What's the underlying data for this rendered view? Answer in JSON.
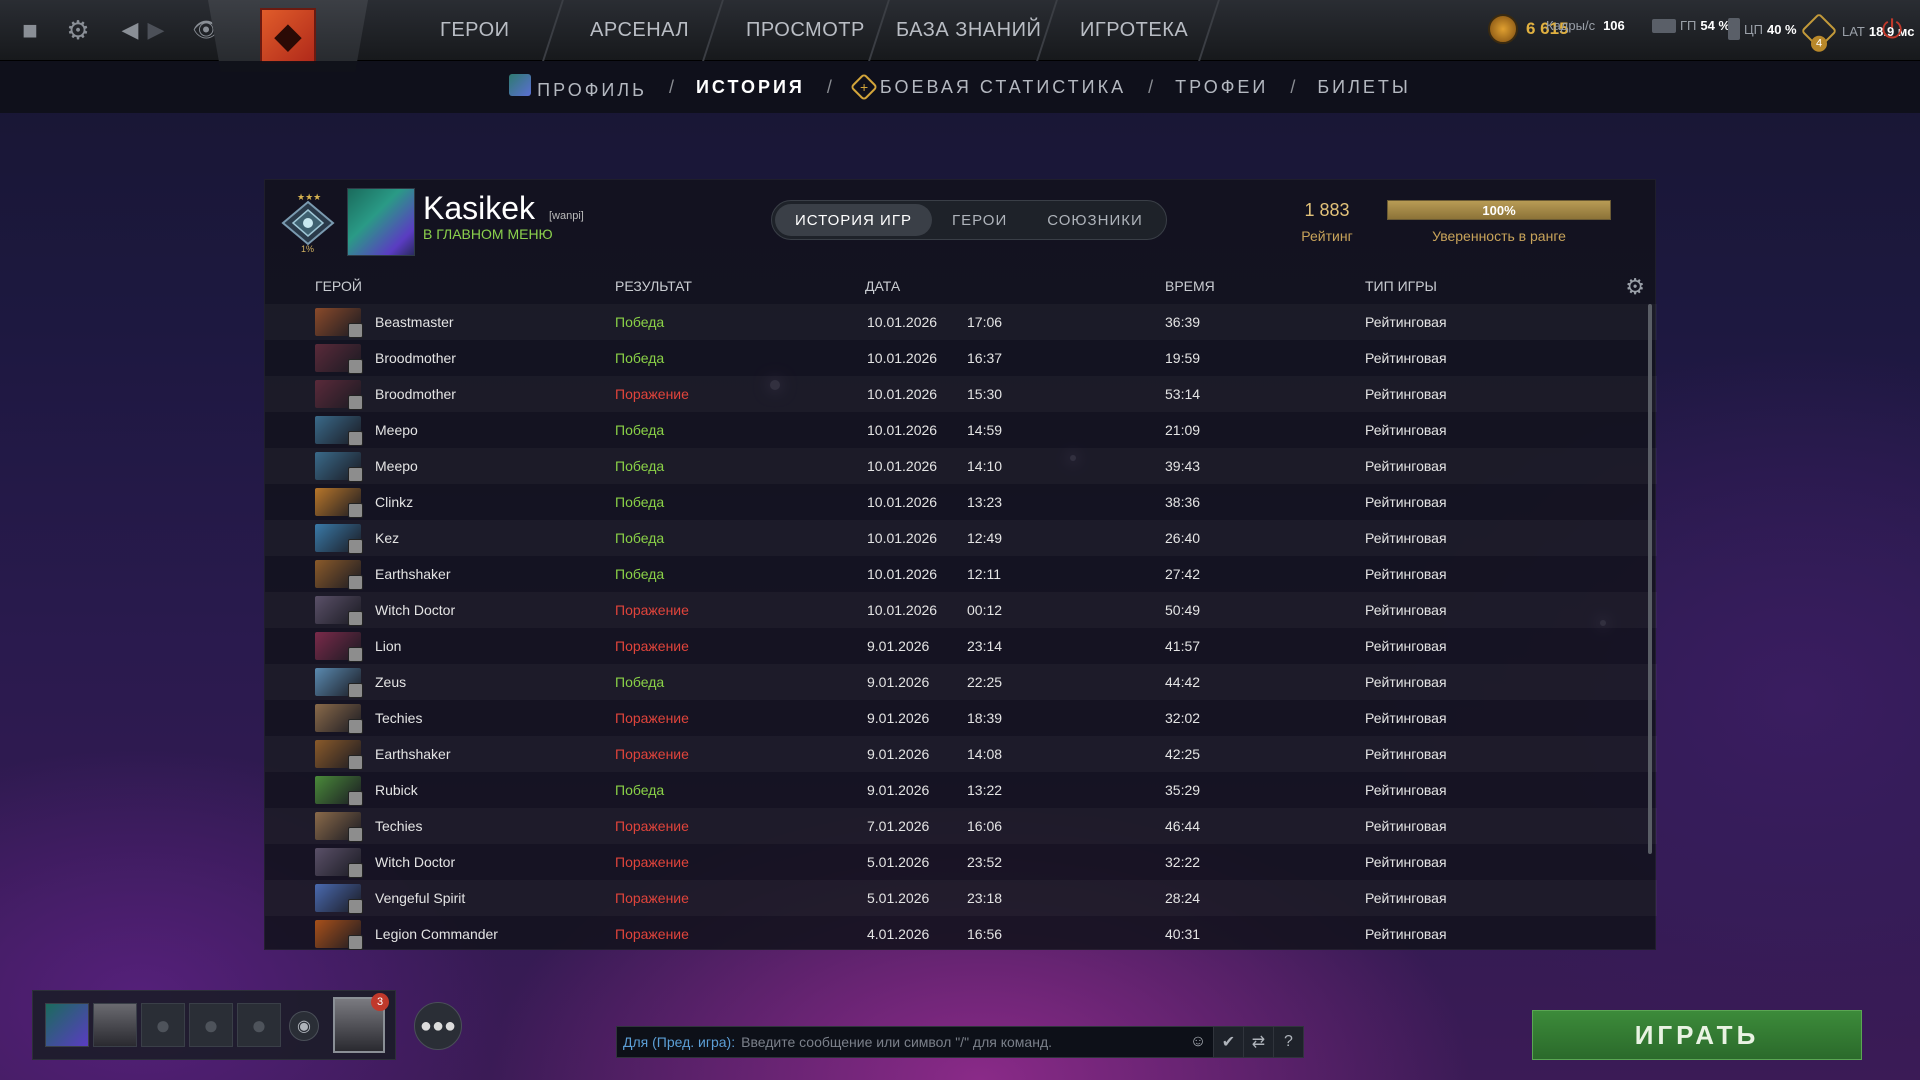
{
  "topbar": {
    "nav": [
      "ГЕРОИ",
      "АРСЕНАЛ",
      "ПРОСМОТР",
      "БАЗА ЗНАНИЙ",
      "ИГРОТЕКА"
    ],
    "stats": {
      "fps_label": "Кадры/с",
      "fps": "106",
      "gpu_label": "ГП",
      "gpu": "54 %",
      "cpu_label": "ЦП",
      "cpu": "40 %",
      "lat_label": "LAT",
      "lat": "18.9 мс",
      "shards": "6 615",
      "badge_count": "4"
    }
  },
  "subnav": {
    "items": [
      "ПРОФИЛЬ",
      "ИСТОРИЯ",
      "БОЕВАЯ СТАТИСТИКА",
      "ТРОФЕИ",
      "БИЛЕТЫ"
    ],
    "active": "ИСТОРИЯ",
    "separator": "/"
  },
  "profile": {
    "name": "Kasikek",
    "tag": "[wanpi]",
    "status": "В ГЛАВНОМ МЕНЮ",
    "rank_percent": "1%",
    "tabs": [
      "ИСТОРИЯ ИГР",
      "ГЕРОИ",
      "СОЮЗНИКИ"
    ],
    "active_tab": "ИСТОРИЯ ИГР",
    "rating_value": "1 883",
    "rating_label": "Рейтинг",
    "confidence_value": "100%",
    "confidence_fraction": 1.0,
    "confidence_label": "Уверенность в ранге"
  },
  "table": {
    "headers": {
      "hero": "ГЕРОЙ",
      "result": "РЕЗУЛЬТАТ",
      "date": "ДАТА",
      "duration": "ВРЕМЯ",
      "type": "ТИП ИГРЫ"
    },
    "rows": [
      {
        "hero": "Beastmaster",
        "result": "Победа",
        "win": true,
        "date": "10.01.2026",
        "time": "17:06",
        "duration": "36:39",
        "type": "Рейтинговая",
        "color": "#8a4a2a"
      },
      {
        "hero": "Broodmother",
        "result": "Победа",
        "win": true,
        "date": "10.01.2026",
        "time": "16:37",
        "duration": "19:59",
        "type": "Рейтинговая",
        "color": "#5a2a3a"
      },
      {
        "hero": "Broodmother",
        "result": "Поражение",
        "win": false,
        "date": "10.01.2026",
        "time": "15:30",
        "duration": "53:14",
        "type": "Рейтинговая",
        "color": "#5a2a3a"
      },
      {
        "hero": "Meepo",
        "result": "Победа",
        "win": true,
        "date": "10.01.2026",
        "time": "14:59",
        "duration": "21:09",
        "type": "Рейтинговая",
        "color": "#3a6a8a"
      },
      {
        "hero": "Meepo",
        "result": "Победа",
        "win": true,
        "date": "10.01.2026",
        "time": "14:10",
        "duration": "39:43",
        "type": "Рейтинговая",
        "color": "#3a6a8a"
      },
      {
        "hero": "Clinkz",
        "result": "Победа",
        "win": true,
        "date": "10.01.2026",
        "time": "13:23",
        "duration": "38:36",
        "type": "Рейтинговая",
        "color": "#b8762a"
      },
      {
        "hero": "Kez",
        "result": "Победа",
        "win": true,
        "date": "10.01.2026",
        "time": "12:49",
        "duration": "26:40",
        "type": "Рейтинговая",
        "color": "#3a7aa8"
      },
      {
        "hero": "Earthshaker",
        "result": "Победа",
        "win": true,
        "date": "10.01.2026",
        "time": "12:11",
        "duration": "27:42",
        "type": "Рейтинговая",
        "color": "#8a5a2a"
      },
      {
        "hero": "Witch Doctor",
        "result": "Поражение",
        "win": false,
        "date": "10.01.2026",
        "time": "00:12",
        "duration": "50:49",
        "type": "Рейтинговая",
        "color": "#5a5068"
      },
      {
        "hero": "Lion",
        "result": "Поражение",
        "win": false,
        "date": "9.01.2026",
        "time": "23:14",
        "duration": "41:57",
        "type": "Рейтинговая",
        "color": "#7a2a4a"
      },
      {
        "hero": "Zeus",
        "result": "Победа",
        "win": true,
        "date": "9.01.2026",
        "time": "22:25",
        "duration": "44:42",
        "type": "Рейтинговая",
        "color": "#5a8ab0"
      },
      {
        "hero": "Techies",
        "result": "Поражение",
        "win": false,
        "date": "9.01.2026",
        "time": "18:39",
        "duration": "32:02",
        "type": "Рейтинговая",
        "color": "#8a6a4a"
      },
      {
        "hero": "Earthshaker",
        "result": "Поражение",
        "win": false,
        "date": "9.01.2026",
        "time": "14:08",
        "duration": "42:25",
        "type": "Рейтинговая",
        "color": "#8a5a2a"
      },
      {
        "hero": "Rubick",
        "result": "Победа",
        "win": true,
        "date": "9.01.2026",
        "time": "13:22",
        "duration": "35:29",
        "type": "Рейтинговая",
        "color": "#4a8a3a"
      },
      {
        "hero": "Techies",
        "result": "Поражение",
        "win": false,
        "date": "7.01.2026",
        "time": "16:06",
        "duration": "46:44",
        "type": "Рейтинговая",
        "color": "#8a6a4a"
      },
      {
        "hero": "Witch Doctor",
        "result": "Поражение",
        "win": false,
        "date": "5.01.2026",
        "time": "23:52",
        "duration": "32:22",
        "type": "Рейтинговая",
        "color": "#5a5068"
      },
      {
        "hero": "Vengeful Spirit",
        "result": "Поражение",
        "win": false,
        "date": "5.01.2026",
        "time": "23:18",
        "duration": "28:24",
        "type": "Рейтинговая",
        "color": "#4a6ab0"
      },
      {
        "hero": "Legion Commander",
        "result": "Поражение",
        "win": false,
        "date": "4.01.2026",
        "time": "16:56",
        "duration": "40:31",
        "type": "Рейтинговая",
        "color": "#a8501a"
      }
    ]
  },
  "bottom": {
    "chat_channel": "Для (Пред. игра):",
    "chat_placeholder": "Введите сообщение или символ \"/\" для команд.",
    "play_label": "ИГРАТЬ",
    "notification_count": "3"
  },
  "colors": {
    "win": "#8ad147",
    "loss": "#e0443b",
    "accent": "#c8a35a"
  }
}
